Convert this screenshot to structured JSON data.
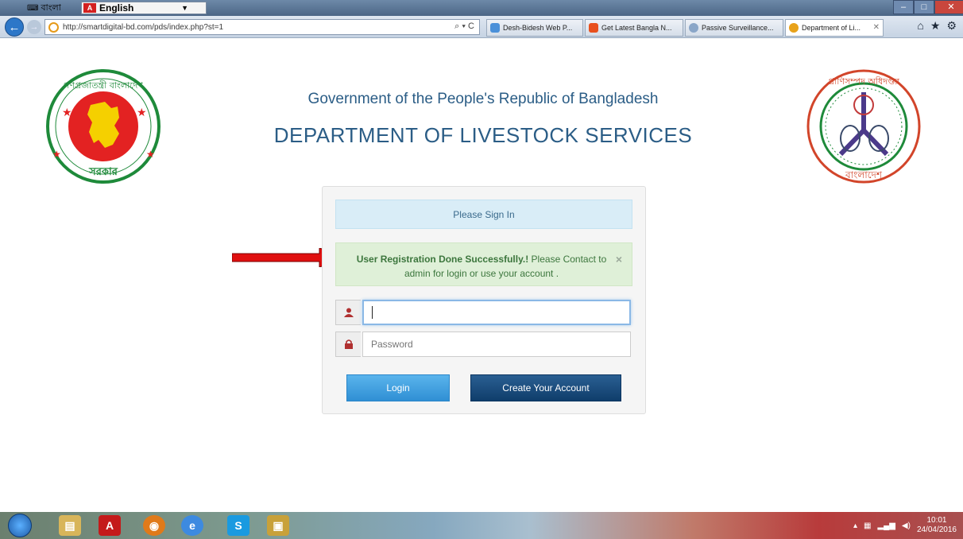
{
  "langbar": {
    "label": "বাংলা",
    "language": "English"
  },
  "browser": {
    "url": "http://smartdigital-bd.com/pds/index.php?st=1",
    "address_tools": "⌕ ▾ C",
    "tabs": [
      {
        "label": "Desh-Bidesh Web P...",
        "color": "#4a90d9"
      },
      {
        "label": "Get Latest Bangla N...",
        "color": "#e8501e"
      },
      {
        "label": "Passive Surveillance...",
        "color": "#8aa6c8"
      },
      {
        "label": "Department of Li...",
        "color": "#e8a21a"
      }
    ],
    "close_glyph": "✕"
  },
  "page": {
    "gov_title": "Government of the People's Republic of Bangladesh",
    "dept_title": "DEPARTMENT OF LIVESTOCK SERVICES",
    "panel_heading": "Please Sign In",
    "alert_bold": "User Registration Done Successfully.!",
    "alert_rest": " Please Contact to admin for login or use your account .",
    "alert_close": "×",
    "username_placeholder": "",
    "password_placeholder": "Password",
    "login_label": "Login",
    "create_label": "Create Your Account"
  },
  "logos": {
    "left_text_top": "গণপ্রজাতন্ত্রী বাংলাদেশ",
    "left_text_bottom": "সরকার",
    "right_text_top": "প্রাণিসম্পদ অধিদপ্তর",
    "right_text_bottom": "বাংলাদেশ"
  },
  "colors": {
    "accent": "#2b5d86",
    "alert_bg": "#dff0d8",
    "info_bg": "#d9edf7",
    "login_btn": "#3399dd",
    "create_btn": "#11406e",
    "arrow": "#e01010"
  },
  "taskbar": {
    "time": "10:01",
    "date": "24/04/2016"
  }
}
